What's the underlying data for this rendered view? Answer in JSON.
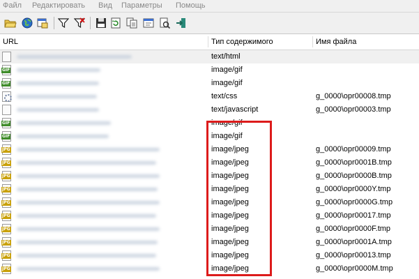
{
  "menu": [
    "Файл",
    "Редактировать",
    "Вид",
    "Параметры",
    "Помощь"
  ],
  "toolbar": [
    "open-folder-icon",
    "globe-icon",
    "open-window-icon",
    "filter-icon",
    "clear-filter-icon",
    "save-icon",
    "refresh-icon",
    "copy-icon",
    "properties-icon",
    "export-icon",
    "exit-icon"
  ],
  "columns": {
    "url": "URL",
    "content_type": "Тип содержимого",
    "file_name": "Имя файла"
  },
  "rows": [
    {
      "icon": "page",
      "type": "text/html",
      "file": ""
    },
    {
      "icon": "gif",
      "type": "image/gif",
      "file": ""
    },
    {
      "icon": "gif",
      "type": "image/gif",
      "file": ""
    },
    {
      "icon": "css",
      "type": "text/css",
      "file": "g_0000\\opr00008.tmp"
    },
    {
      "icon": "page",
      "type": "text/javascript",
      "file": "g_0000\\opr00003.tmp"
    },
    {
      "icon": "gif",
      "type": "image/gif",
      "file": ""
    },
    {
      "icon": "gif",
      "type": "image/gif",
      "file": ""
    },
    {
      "icon": "jpg",
      "type": "image/jpeg",
      "file": "g_0000\\opr00009.tmp"
    },
    {
      "icon": "jpg",
      "type": "image/jpeg",
      "file": "g_0000\\opr0001B.tmp"
    },
    {
      "icon": "jpg",
      "type": "image/jpeg",
      "file": "g_0000\\opr0000B.tmp"
    },
    {
      "icon": "jpg",
      "type": "image/jpeg",
      "file": "g_0000\\opr0000Y.tmp"
    },
    {
      "icon": "jpg",
      "type": "image/jpeg",
      "file": "g_0000\\opr0000G.tmp"
    },
    {
      "icon": "jpg",
      "type": "image/jpeg",
      "file": "g_0000\\opr00017.tmp"
    },
    {
      "icon": "jpg",
      "type": "image/jpeg",
      "file": "g_0000\\opr0000F.tmp"
    },
    {
      "icon": "jpg",
      "type": "image/jpeg",
      "file": "g_0000\\opr0001A.tmp"
    },
    {
      "icon": "jpg",
      "type": "image/jpeg",
      "file": "g_0000\\opr00013.tmp"
    },
    {
      "icon": "jpg",
      "type": "image/jpeg",
      "file": "g_0000\\opr0000M.tmp"
    }
  ],
  "colors": {
    "highlight": "#dd1b1b",
    "gif_badge": "#3f8c2a",
    "jpg_badge": "#c9a10a"
  }
}
